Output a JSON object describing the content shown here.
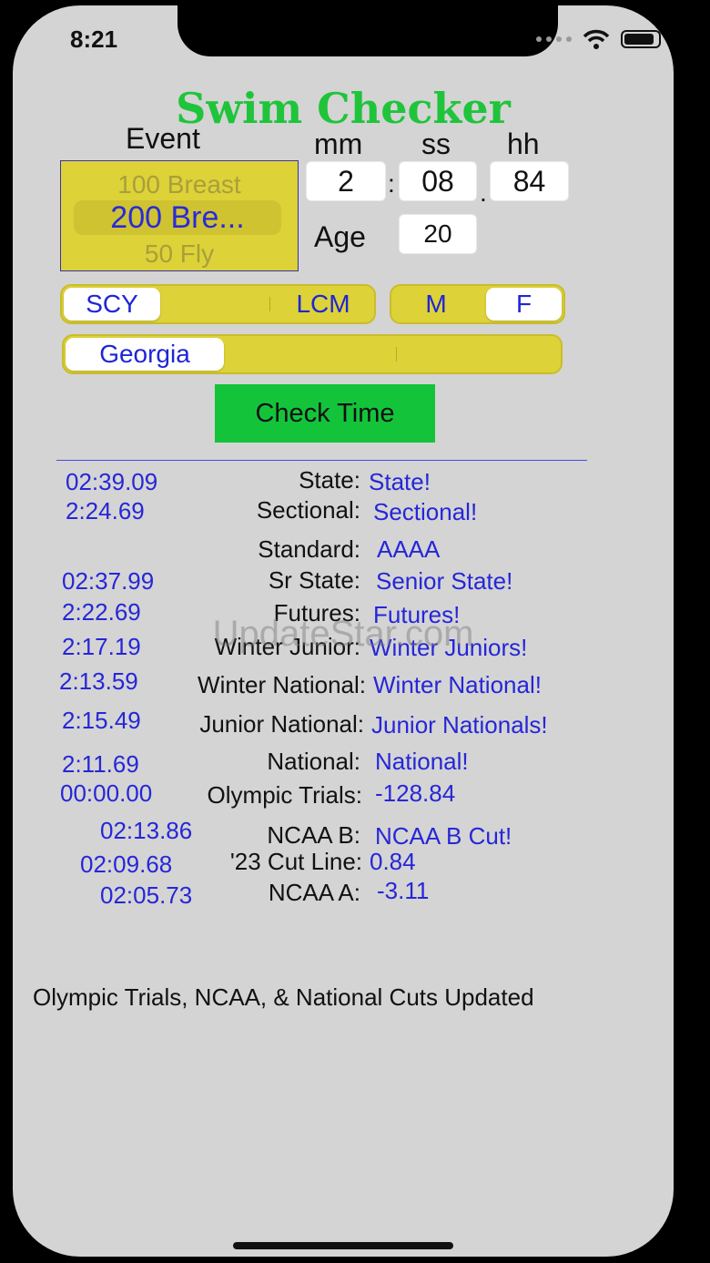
{
  "status": {
    "time": "8:21"
  },
  "app": {
    "title": "Swim Checker"
  },
  "labels": {
    "event": "Event",
    "mm": "mm",
    "ss": "ss",
    "hh": "hh",
    "age": "Age",
    "colon": ":",
    "dot": "."
  },
  "event_picker": {
    "above": "100 Breast",
    "selected": "200 Bre...",
    "below": "50 Fly"
  },
  "time_input": {
    "mm": "2",
    "ss": "08",
    "hh": "84"
  },
  "age_input": {
    "value": "20"
  },
  "course_segment": {
    "options": [
      "SCY",
      "",
      "LCM"
    ],
    "selected": "SCY"
  },
  "gender_segment": {
    "options": [
      "M",
      "F"
    ],
    "selected": "F"
  },
  "state_segment": {
    "options": [
      "Georgia",
      "",
      ""
    ],
    "selected": "Georgia"
  },
  "check_button": {
    "label": "Check Time"
  },
  "results": [
    {
      "cut": "02:39.09",
      "label": "State:",
      "result": "State!"
    },
    {
      "cut": "2:24.69",
      "label": "Sectional:",
      "result": "Sectional!"
    },
    {
      "cut": "",
      "label": "Standard:",
      "result": "AAAA"
    },
    {
      "cut": "02:37.99",
      "label": "Sr State:",
      "result": "Senior State!"
    },
    {
      "cut": "2:22.69",
      "label": "Futures:",
      "result": "Futures!"
    },
    {
      "cut": "2:17.19",
      "label": "Winter Junior:",
      "result": "Winter Juniors!"
    },
    {
      "cut": "2:13.59",
      "label": "Winter National:",
      "result": "Winter National!"
    },
    {
      "cut": "2:15.49",
      "label": "Junior National:",
      "result": "Junior Nationals!"
    },
    {
      "cut": "2:11.69",
      "label": "National:",
      "result": "National!"
    },
    {
      "cut": "00:00.00",
      "label": "Olympic Trials:",
      "result": "-128.84"
    },
    {
      "cut": "02:13.86",
      "label": "NCAA B:",
      "result": "NCAA B Cut!"
    },
    {
      "cut": "02:09.68",
      "label": "'23 Cut Line:",
      "result": "0.84"
    },
    {
      "cut": "02:05.73",
      "label": "NCAA A:",
      "result": "-3.11"
    }
  ],
  "footer": {
    "text": "Olympic Trials, NCAA, & National Cuts Updated"
  },
  "watermark": {
    "text": "UpdateStar.com"
  },
  "colors": {
    "title_green": "#1fc43a",
    "accent_yellow": "#ddd238",
    "text_blue": "#2626d8",
    "button_green": "#13c43a"
  }
}
